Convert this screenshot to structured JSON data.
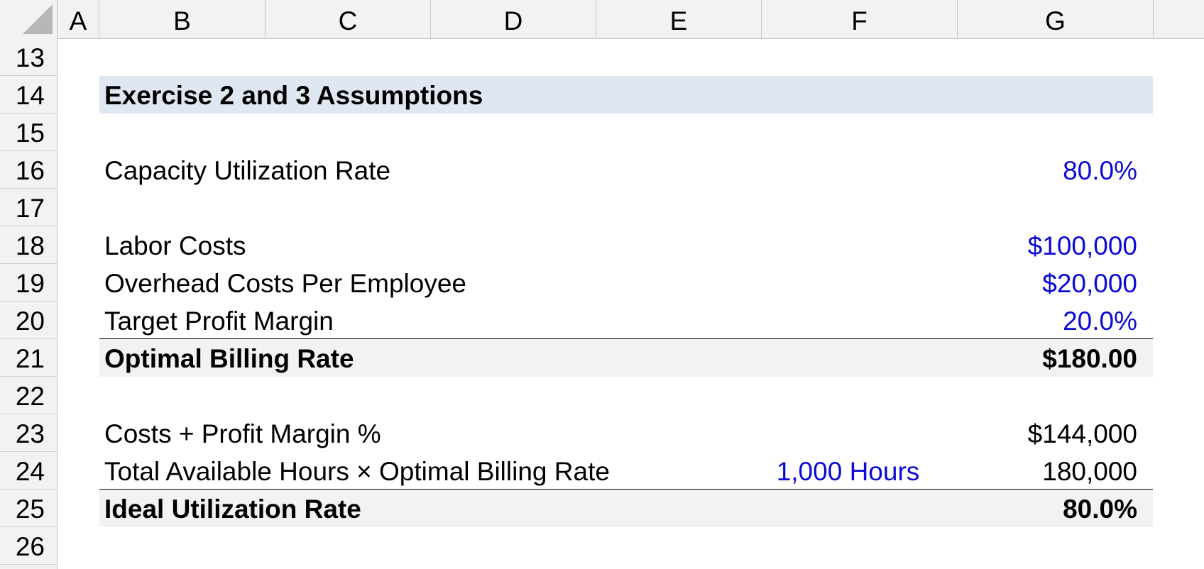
{
  "columns": [
    "A",
    "B",
    "C",
    "D",
    "E",
    "F",
    "G"
  ],
  "rows": [
    "13",
    "14",
    "15",
    "16",
    "17",
    "18",
    "19",
    "20",
    "21",
    "22",
    "23",
    "24",
    "25",
    "26"
  ],
  "title": "Exercise 2 and 3 Assumptions",
  "capacity": {
    "label": "Capacity Utilization Rate",
    "value": "80.0%"
  },
  "labor": {
    "label": "Labor Costs",
    "value": "$100,000"
  },
  "overhead": {
    "label": "Overhead Costs Per Employee",
    "value": "$20,000"
  },
  "margin": {
    "label": "Target Profit Margin",
    "value": "20.0%"
  },
  "billing": {
    "label": "Optimal Billing Rate",
    "value": "$180.00"
  },
  "costs_profit": {
    "label": "Costs + Profit Margin %",
    "value": "$144,000"
  },
  "hours": {
    "label": "Total Available Hours × Optimal Billing Rate",
    "hours": "1,000 Hours",
    "value": "180,000"
  },
  "ideal": {
    "label": "Ideal Utilization Rate",
    "value": "80.0%"
  },
  "colors": {
    "input_blue": "#0b0bd3",
    "title_fill": "#dfe8f2",
    "total_fill": "#f2f2f2",
    "header_fill": "#f2f2f2"
  }
}
